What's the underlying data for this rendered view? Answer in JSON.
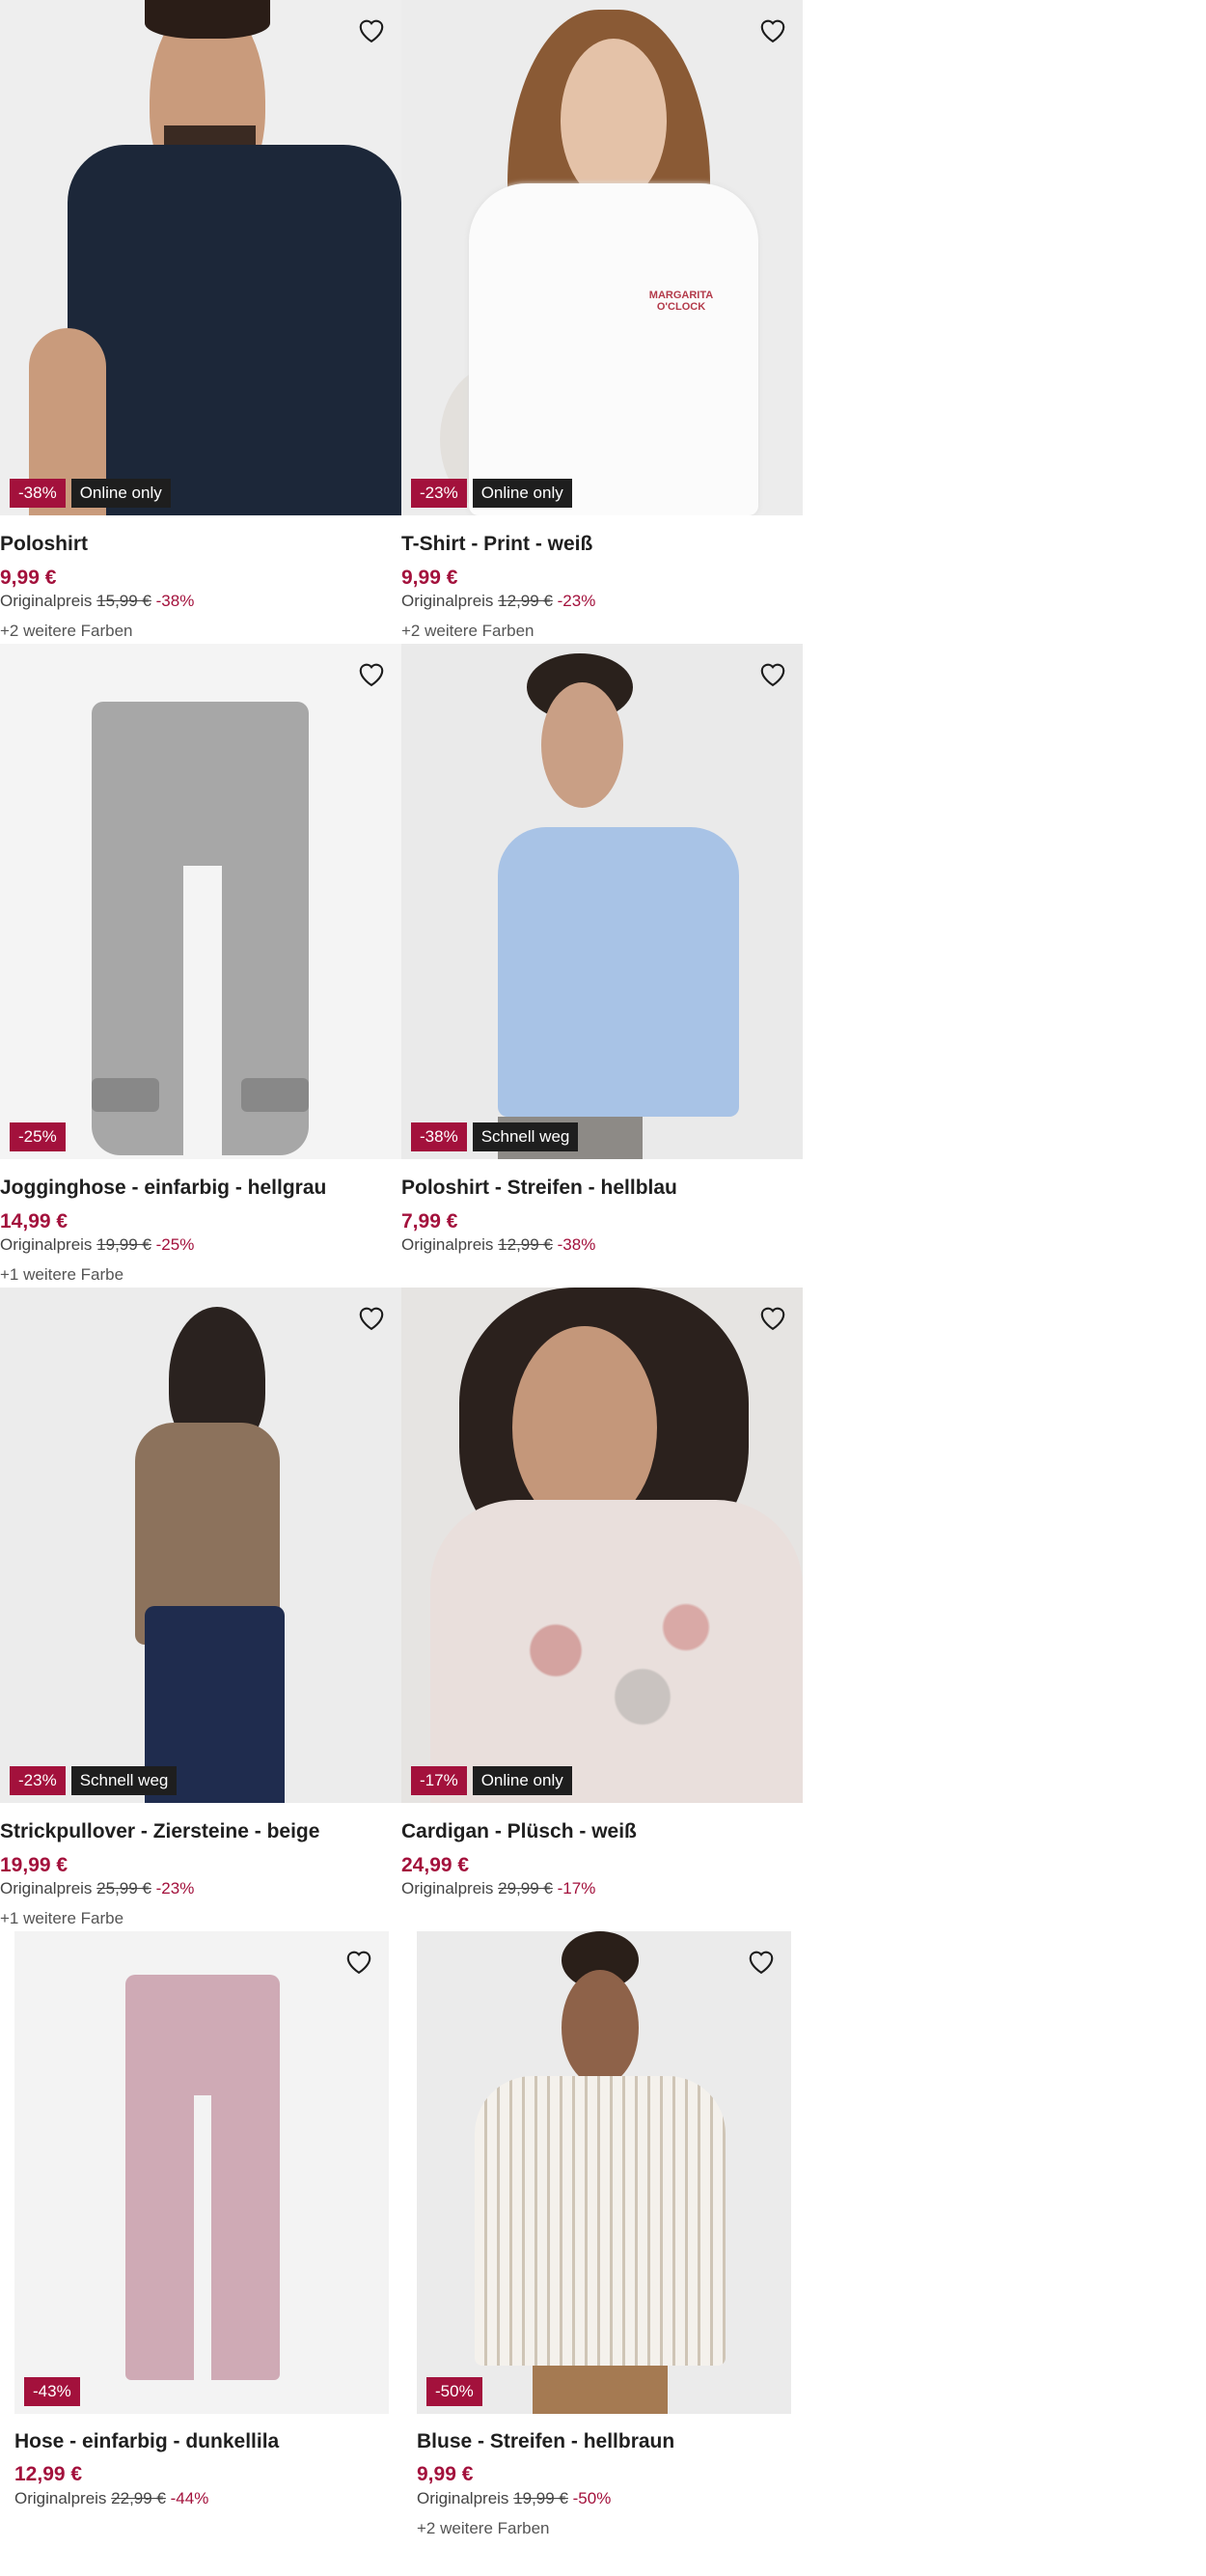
{
  "products": [
    {
      "name": "Poloshirt",
      "price": "9,99 €",
      "orig_label": "Originalpreis",
      "orig_price": "15,99 €",
      "orig_discount": "-38%",
      "colors": "+2 weitere Farben",
      "badge_discount": "-38%",
      "badge_info": "Online only"
    },
    {
      "name": "T-Shirt - Print - weiß",
      "price": "9,99 €",
      "orig_label": "Originalpreis",
      "orig_price": "12,99 €",
      "orig_discount": "-23%",
      "colors": "+2 weitere Farben",
      "badge_discount": "-23%",
      "badge_info": "Online only"
    },
    {
      "name": "Jogginghose - einfarbig - hellgrau",
      "price": "14,99 €",
      "orig_label": "Originalpreis",
      "orig_price": "19,99 €",
      "orig_discount": "-25%",
      "colors": "+1 weitere Farbe",
      "badge_discount": "-25%",
      "badge_info": ""
    },
    {
      "name": "Poloshirt - Streifen - hellblau",
      "price": "7,99 €",
      "orig_label": "Originalpreis",
      "orig_price": "12,99 €",
      "orig_discount": "-38%",
      "colors": "",
      "badge_discount": "-38%",
      "badge_info": "Schnell weg"
    },
    {
      "name": "Strickpullover - Ziersteine - beige",
      "price": "19,99 €",
      "orig_label": "Originalpreis",
      "orig_price": "25,99 €",
      "orig_discount": "-23%",
      "colors": "+1 weitere Farbe",
      "badge_discount": "-23%",
      "badge_info": "Schnell weg"
    },
    {
      "name": "Cardigan - Plüsch - weiß",
      "price": "24,99 €",
      "orig_label": "Originalpreis",
      "orig_price": "29,99 €",
      "orig_discount": "-17%",
      "colors": "",
      "badge_discount": "-17%",
      "badge_info": "Online only"
    },
    {
      "name": "Hose - einfarbig - dunkellila",
      "price": "12,99 €",
      "orig_label": "Originalpreis",
      "orig_price": "22,99 €",
      "orig_discount": "-44%",
      "colors": "",
      "badge_discount": "-43%",
      "badge_info": ""
    },
    {
      "name": "Bluse - Streifen - hellbraun",
      "price": "9,99 €",
      "orig_label": "Originalpreis",
      "orig_price": "19,99 €",
      "orig_discount": "-50%",
      "colors": "+2 weitere Farben",
      "badge_discount": "-50%",
      "badge_info": ""
    }
  ],
  "icons": {
    "favorite": "heart-outline-icon"
  },
  "colors": {
    "accent": "#a3113c",
    "badge_dark": "#1e1e1e",
    "image_bg": "#ededed"
  }
}
